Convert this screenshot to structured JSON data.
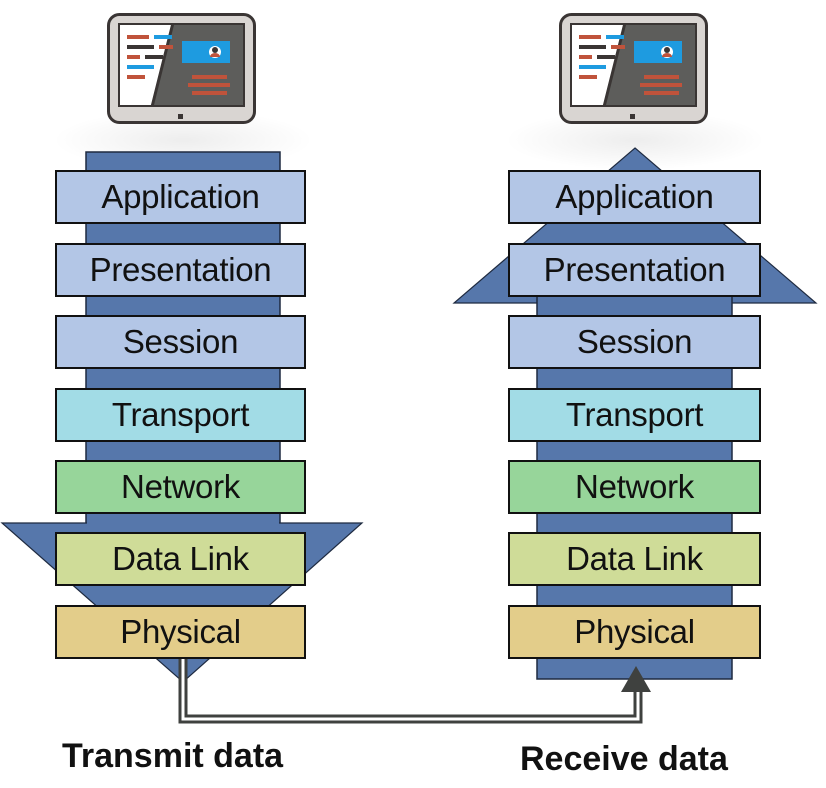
{
  "layers": [
    {
      "name": "Application",
      "color": "#b3c6e6"
    },
    {
      "name": "Presentation",
      "color": "#b3c6e6"
    },
    {
      "name": "Session",
      "color": "#b3c6e6"
    },
    {
      "name": "Transport",
      "color": "#a2dce6"
    },
    {
      "name": "Network",
      "color": "#97d59a"
    },
    {
      "name": "Data Link",
      "color": "#cfdc98"
    },
    {
      "name": "Physical",
      "color": "#e3cd8a"
    }
  ],
  "stacks": {
    "sender": {
      "caption": "Transmit data",
      "direction": "down"
    },
    "receiver": {
      "caption": "Receive data",
      "direction": "up"
    }
  },
  "colors": {
    "arrow": "#5677ab",
    "cable": "#3f413f",
    "monitor_frame": "#3a3534",
    "monitor_bezel": "#d9d5d2"
  },
  "icons": {
    "sender_device": "computer-monitor-icon",
    "receiver_device": "computer-monitor-icon"
  }
}
